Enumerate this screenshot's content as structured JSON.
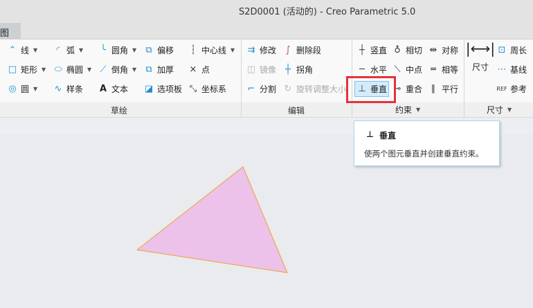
{
  "window": {
    "title": "S2D0001 (活动的) - Creo Parametric 5.0",
    "tab": "图"
  },
  "sketch": {
    "label": "草绘",
    "items": [
      {
        "label": "线",
        "icon": "line-icon"
      },
      {
        "label": "矩形",
        "icon": "rectangle-icon"
      },
      {
        "label": "圆",
        "icon": "circle-icon"
      },
      {
        "label": "弧",
        "icon": "arc-icon"
      },
      {
        "label": "椭圆",
        "icon": "ellipse-icon"
      },
      {
        "label": "样条",
        "icon": "spline-icon"
      },
      {
        "label": "圆角",
        "icon": "fillet-icon"
      },
      {
        "label": "倒角",
        "icon": "chamfer-icon"
      },
      {
        "label": "文本",
        "icon": "text-icon"
      },
      {
        "label": "偏移",
        "icon": "offset-icon"
      },
      {
        "label": "加厚",
        "icon": "thicken-icon"
      },
      {
        "label": "选项板",
        "icon": "palette-icon"
      },
      {
        "label": "中心线",
        "icon": "centerline-icon"
      },
      {
        "label": "点",
        "icon": "point-icon"
      },
      {
        "label": "坐标系",
        "icon": "coordinate-system-icon"
      }
    ]
  },
  "edit": {
    "label": "编辑",
    "items": [
      {
        "label": "修改"
      },
      {
        "label": "镜像"
      },
      {
        "label": "分割"
      },
      {
        "label": "删除段"
      },
      {
        "label": "拐角"
      },
      {
        "label": "旋转调整大小"
      }
    ]
  },
  "constrain": {
    "label": "约束",
    "items": [
      {
        "label": "竖直"
      },
      {
        "label": "水平"
      },
      {
        "label": "垂直"
      },
      {
        "label": "相切"
      },
      {
        "label": "中点"
      },
      {
        "label": "重合"
      },
      {
        "label": "对称"
      },
      {
        "label": "相等"
      },
      {
        "label": "平行"
      }
    ]
  },
  "dimension": {
    "label": "尺寸",
    "items": [
      {
        "label": "尺寸"
      },
      {
        "label": "周长"
      },
      {
        "label": "基线"
      },
      {
        "label": "参考"
      }
    ]
  },
  "tooltip": {
    "title": "垂直",
    "description": "使两个图元垂直并创建垂直约束。"
  },
  "colors": {
    "triangle_fill": "#ecc2ea",
    "triangle_stroke": "#f0a030",
    "highlight": "#e8303a"
  }
}
